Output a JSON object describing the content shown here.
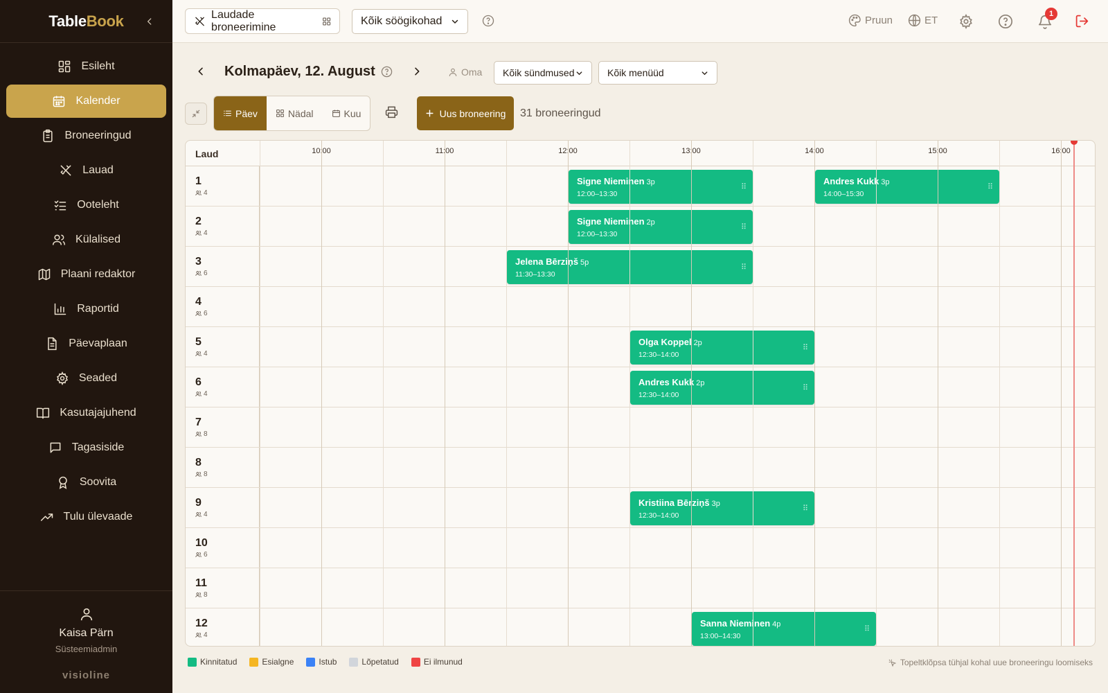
{
  "sidebar": {
    "brand_part1": "Table",
    "brand_part2": "Book",
    "items": [
      {
        "label": "Esileht",
        "icon": "dashboard-icon"
      },
      {
        "label": "Kalender",
        "icon": "calendar-icon",
        "active": true
      },
      {
        "label": "Broneeringud",
        "icon": "clipboard-icon"
      },
      {
        "label": "Lauad",
        "icon": "utensils-icon"
      },
      {
        "label": "Ooteleht",
        "icon": "checklist-icon"
      },
      {
        "label": "Külalised",
        "icon": "users-icon"
      },
      {
        "label": "Plaani redaktor",
        "icon": "map-icon"
      },
      {
        "label": "Raportid",
        "icon": "bar-chart-icon"
      },
      {
        "label": "Päevaplaan",
        "icon": "document-icon"
      },
      {
        "label": "Seaded",
        "icon": "gear-icon"
      },
      {
        "label": "Kasutajajuhend",
        "icon": "book-icon"
      },
      {
        "label": "Tagasiside",
        "icon": "message-icon"
      },
      {
        "label": "Soovita",
        "icon": "award-icon"
      },
      {
        "label": "Tulu ülevaade",
        "icon": "trending-up-icon"
      }
    ],
    "user": {
      "name": "Kaisa Pärn",
      "role": "Süsteemiadmin"
    },
    "vendor": "visioline"
  },
  "topbar": {
    "module": "Laudade broneerimine",
    "venue": "Kõik söögikohad",
    "theme": "Pruun",
    "language": "ET",
    "notifications": "1"
  },
  "date_bar": {
    "title": "Kolmapäev, 12. August",
    "own": "Oma",
    "events_filter": "Kõik sündmused",
    "menus_filter": "Kõik menüüd"
  },
  "toolbar": {
    "views": [
      "Päev",
      "Nädal",
      "Kuu"
    ],
    "active_view": "Päev",
    "new_booking": "Uus broneering",
    "count": "31 broneeringud"
  },
  "calendar": {
    "column_header": "Laud",
    "start_hour": 9.5,
    "hours": [
      "10:00",
      "11:00",
      "12:00",
      "13:00",
      "14:00",
      "15:00",
      "16:00"
    ],
    "hour_values": [
      10,
      11,
      12,
      13,
      14,
      15,
      16
    ],
    "now": 16.1,
    "tables": [
      {
        "num": "1",
        "cap": "4"
      },
      {
        "num": "2",
        "cap": "4"
      },
      {
        "num": "3",
        "cap": "6"
      },
      {
        "num": "4",
        "cap": "6"
      },
      {
        "num": "5",
        "cap": "4"
      },
      {
        "num": "6",
        "cap": "4"
      },
      {
        "num": "7",
        "cap": "8"
      },
      {
        "num": "8",
        "cap": "8"
      },
      {
        "num": "9",
        "cap": "4"
      },
      {
        "num": "10",
        "cap": "6"
      },
      {
        "num": "11",
        "cap": "8"
      },
      {
        "num": "12",
        "cap": "4"
      }
    ],
    "bookings": [
      {
        "row": 0,
        "start": 12.0,
        "end": 13.5,
        "name": "Signe Nieminen",
        "pax": "3p",
        "time": "12:00–13:30"
      },
      {
        "row": 0,
        "start": 14.0,
        "end": 15.5,
        "name": "Andres Kukk",
        "pax": "3p",
        "time": "14:00–15:30"
      },
      {
        "row": 1,
        "start": 12.0,
        "end": 13.5,
        "name": "Signe Nieminen",
        "pax": "2p",
        "time": "12:00–13:30"
      },
      {
        "row": 2,
        "start": 11.5,
        "end": 13.5,
        "name": "Jelena Bērziņš",
        "pax": "5p",
        "time": "11:30–13:30"
      },
      {
        "row": 4,
        "start": 12.5,
        "end": 14.0,
        "name": "Olga Koppel",
        "pax": "2p",
        "time": "12:30–14:00"
      },
      {
        "row": 5,
        "start": 12.5,
        "end": 14.0,
        "name": "Andres Kukk",
        "pax": "2p",
        "time": "12:30–14:00"
      },
      {
        "row": 8,
        "start": 12.5,
        "end": 14.0,
        "name": "Kristiina Bērziņš",
        "pax": "3p",
        "time": "12:30–14:00"
      },
      {
        "row": 11,
        "start": 13.0,
        "end": 14.5,
        "name": "Sanna Nieminen",
        "pax": "4p",
        "time": "13:00–14:30"
      }
    ]
  },
  "legend": [
    {
      "label": "Kinnitatud",
      "color": "#14bb83"
    },
    {
      "label": "Esialgne",
      "color": "#f5b623"
    },
    {
      "label": "Istub",
      "color": "#3b82f6"
    },
    {
      "label": "Lõpetatud",
      "color": "#d1d5db"
    },
    {
      "label": "Ei ilmunud",
      "color": "#ef4444"
    }
  ],
  "hint": "Topeltklõpsa tühjal kohal uue broneeringu loomiseks",
  "colors": {
    "accent": "#c9a44c",
    "primary": "#8a6418",
    "sidebar": "#21160f",
    "confirmed": "#14bb83"
  }
}
